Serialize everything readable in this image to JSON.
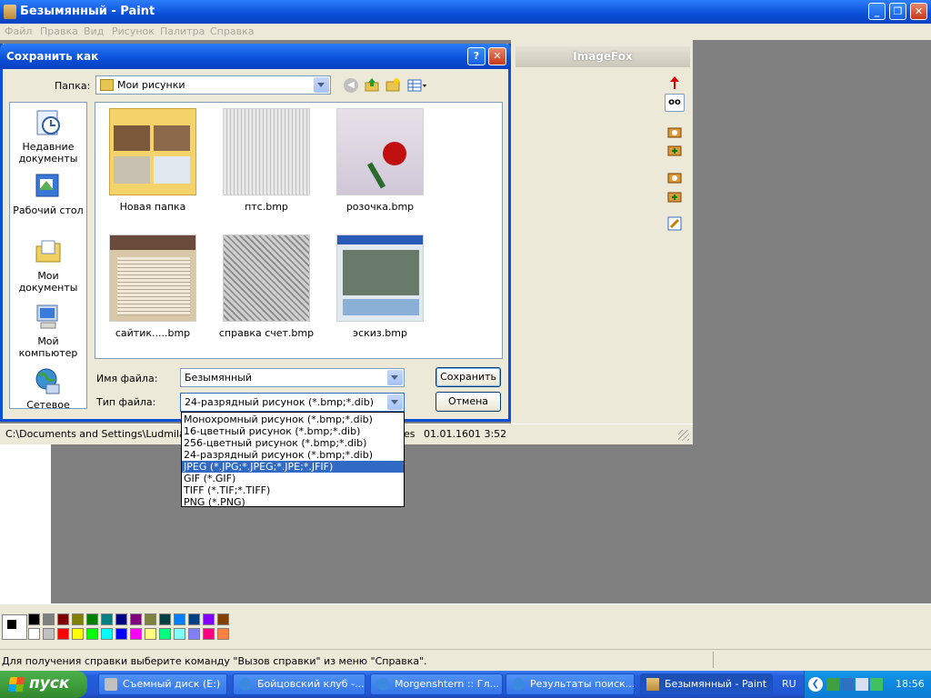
{
  "paint": {
    "title": "Безымянный - Paint",
    "menu": [
      "Файл",
      "Правка",
      "Вид",
      "Рисунок",
      "Палитра",
      "Справка"
    ],
    "status_path": "C:\\Documents and Settings\\Ludmila1\\Mo",
    "status_es": "es",
    "status_date": "01.01.1601 3:52",
    "help_status": "Для получения справки выберите команду \"Вызов справки\" из меню \"Справка\".",
    "palette_colors": [
      "#000000",
      "#808080",
      "#800000",
      "#808000",
      "#008000",
      "#008080",
      "#000080",
      "#800080",
      "#808040",
      "#004040",
      "#0080ff",
      "#004080",
      "#8000ff",
      "#804000",
      "#ffffff",
      "#c0c0c0",
      "#ff0000",
      "#ffff00",
      "#00ff00",
      "#00ffff",
      "#0000ff",
      "#ff00ff",
      "#ffff80",
      "#00ff80",
      "#80ffff",
      "#8080ff",
      "#ff0080",
      "#ff8040"
    ]
  },
  "imagefox": {
    "title": "ImageFox"
  },
  "dialog": {
    "title": "Сохранить как",
    "help_btn": "?",
    "folder_label": "Папка:",
    "folder_value": "Мои рисунки",
    "places": [
      {
        "label": "Недавние документы"
      },
      {
        "label": "Рабочий стол"
      },
      {
        "label": "Мои документы"
      },
      {
        "label": "Мой компьютер"
      },
      {
        "label": "Сетевое"
      }
    ],
    "files": [
      {
        "name": "Новая папка"
      },
      {
        "name": "птс.bmp"
      },
      {
        "name": "розочка.bmp"
      },
      {
        "name": "сайтик.....bmp"
      },
      {
        "name": "справка счет.bmp"
      },
      {
        "name": "эскиз.bmp"
      }
    ],
    "filename_label": "Имя файла:",
    "filename_value": "Безымянный",
    "filetype_label": "Тип файла:",
    "filetype_value": "24-разрядный рисунок (*.bmp;*.dib)",
    "save_button": "Сохранить",
    "cancel_button": "Отмена",
    "filetype_options": [
      "Монохромный рисунок (*.bmp;*.dib)",
      "16-цветный рисунок (*.bmp;*.dib)",
      "256-цветный рисунок (*.bmp;*.dib)",
      "24-разрядный рисунок (*.bmp;*.dib)",
      "JPEG (*.JPG;*.JPEG;*.JPE;*.JFIF)",
      "GIF (*.GIF)",
      "TIFF (*.TIF;*.TIFF)",
      "PNG (*.PNG)"
    ],
    "selected_option_index": 4
  },
  "taskbar": {
    "start": "пуск",
    "tasks": [
      {
        "label": "Съемный диск (E:)"
      },
      {
        "label": "Бойцовский клуб -..."
      },
      {
        "label": "Morgenshtern :: Гл..."
      },
      {
        "label": "Результаты поиск..."
      },
      {
        "label": "Безымянный - Paint"
      }
    ],
    "lang": "RU",
    "clock": "18:56"
  }
}
